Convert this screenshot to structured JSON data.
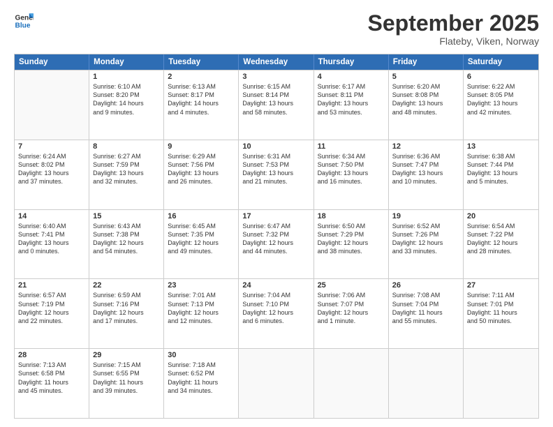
{
  "header": {
    "logo_general": "General",
    "logo_blue": "Blue",
    "month": "September 2025",
    "location": "Flateby, Viken, Norway"
  },
  "days": [
    "Sunday",
    "Monday",
    "Tuesday",
    "Wednesday",
    "Thursday",
    "Friday",
    "Saturday"
  ],
  "rows": [
    [
      {
        "day": "",
        "lines": []
      },
      {
        "day": "1",
        "lines": [
          "Sunrise: 6:10 AM",
          "Sunset: 8:20 PM",
          "Daylight: 14 hours",
          "and 9 minutes."
        ]
      },
      {
        "day": "2",
        "lines": [
          "Sunrise: 6:13 AM",
          "Sunset: 8:17 PM",
          "Daylight: 14 hours",
          "and 4 minutes."
        ]
      },
      {
        "day": "3",
        "lines": [
          "Sunrise: 6:15 AM",
          "Sunset: 8:14 PM",
          "Daylight: 13 hours",
          "and 58 minutes."
        ]
      },
      {
        "day": "4",
        "lines": [
          "Sunrise: 6:17 AM",
          "Sunset: 8:11 PM",
          "Daylight: 13 hours",
          "and 53 minutes."
        ]
      },
      {
        "day": "5",
        "lines": [
          "Sunrise: 6:20 AM",
          "Sunset: 8:08 PM",
          "Daylight: 13 hours",
          "and 48 minutes."
        ]
      },
      {
        "day": "6",
        "lines": [
          "Sunrise: 6:22 AM",
          "Sunset: 8:05 PM",
          "Daylight: 13 hours",
          "and 42 minutes."
        ]
      }
    ],
    [
      {
        "day": "7",
        "lines": [
          "Sunrise: 6:24 AM",
          "Sunset: 8:02 PM",
          "Daylight: 13 hours",
          "and 37 minutes."
        ]
      },
      {
        "day": "8",
        "lines": [
          "Sunrise: 6:27 AM",
          "Sunset: 7:59 PM",
          "Daylight: 13 hours",
          "and 32 minutes."
        ]
      },
      {
        "day": "9",
        "lines": [
          "Sunrise: 6:29 AM",
          "Sunset: 7:56 PM",
          "Daylight: 13 hours",
          "and 26 minutes."
        ]
      },
      {
        "day": "10",
        "lines": [
          "Sunrise: 6:31 AM",
          "Sunset: 7:53 PM",
          "Daylight: 13 hours",
          "and 21 minutes."
        ]
      },
      {
        "day": "11",
        "lines": [
          "Sunrise: 6:34 AM",
          "Sunset: 7:50 PM",
          "Daylight: 13 hours",
          "and 16 minutes."
        ]
      },
      {
        "day": "12",
        "lines": [
          "Sunrise: 6:36 AM",
          "Sunset: 7:47 PM",
          "Daylight: 13 hours",
          "and 10 minutes."
        ]
      },
      {
        "day": "13",
        "lines": [
          "Sunrise: 6:38 AM",
          "Sunset: 7:44 PM",
          "Daylight: 13 hours",
          "and 5 minutes."
        ]
      }
    ],
    [
      {
        "day": "14",
        "lines": [
          "Sunrise: 6:40 AM",
          "Sunset: 7:41 PM",
          "Daylight: 13 hours",
          "and 0 minutes."
        ]
      },
      {
        "day": "15",
        "lines": [
          "Sunrise: 6:43 AM",
          "Sunset: 7:38 PM",
          "Daylight: 12 hours",
          "and 54 minutes."
        ]
      },
      {
        "day": "16",
        "lines": [
          "Sunrise: 6:45 AM",
          "Sunset: 7:35 PM",
          "Daylight: 12 hours",
          "and 49 minutes."
        ]
      },
      {
        "day": "17",
        "lines": [
          "Sunrise: 6:47 AM",
          "Sunset: 7:32 PM",
          "Daylight: 12 hours",
          "and 44 minutes."
        ]
      },
      {
        "day": "18",
        "lines": [
          "Sunrise: 6:50 AM",
          "Sunset: 7:29 PM",
          "Daylight: 12 hours",
          "and 38 minutes."
        ]
      },
      {
        "day": "19",
        "lines": [
          "Sunrise: 6:52 AM",
          "Sunset: 7:26 PM",
          "Daylight: 12 hours",
          "and 33 minutes."
        ]
      },
      {
        "day": "20",
        "lines": [
          "Sunrise: 6:54 AM",
          "Sunset: 7:22 PM",
          "Daylight: 12 hours",
          "and 28 minutes."
        ]
      }
    ],
    [
      {
        "day": "21",
        "lines": [
          "Sunrise: 6:57 AM",
          "Sunset: 7:19 PM",
          "Daylight: 12 hours",
          "and 22 minutes."
        ]
      },
      {
        "day": "22",
        "lines": [
          "Sunrise: 6:59 AM",
          "Sunset: 7:16 PM",
          "Daylight: 12 hours",
          "and 17 minutes."
        ]
      },
      {
        "day": "23",
        "lines": [
          "Sunrise: 7:01 AM",
          "Sunset: 7:13 PM",
          "Daylight: 12 hours",
          "and 12 minutes."
        ]
      },
      {
        "day": "24",
        "lines": [
          "Sunrise: 7:04 AM",
          "Sunset: 7:10 PM",
          "Daylight: 12 hours",
          "and 6 minutes."
        ]
      },
      {
        "day": "25",
        "lines": [
          "Sunrise: 7:06 AM",
          "Sunset: 7:07 PM",
          "Daylight: 12 hours",
          "and 1 minute."
        ]
      },
      {
        "day": "26",
        "lines": [
          "Sunrise: 7:08 AM",
          "Sunset: 7:04 PM",
          "Daylight: 11 hours",
          "and 55 minutes."
        ]
      },
      {
        "day": "27",
        "lines": [
          "Sunrise: 7:11 AM",
          "Sunset: 7:01 PM",
          "Daylight: 11 hours",
          "and 50 minutes."
        ]
      }
    ],
    [
      {
        "day": "28",
        "lines": [
          "Sunrise: 7:13 AM",
          "Sunset: 6:58 PM",
          "Daylight: 11 hours",
          "and 45 minutes."
        ]
      },
      {
        "day": "29",
        "lines": [
          "Sunrise: 7:15 AM",
          "Sunset: 6:55 PM",
          "Daylight: 11 hours",
          "and 39 minutes."
        ]
      },
      {
        "day": "30",
        "lines": [
          "Sunrise: 7:18 AM",
          "Sunset: 6:52 PM",
          "Daylight: 11 hours",
          "and 34 minutes."
        ]
      },
      {
        "day": "",
        "lines": []
      },
      {
        "day": "",
        "lines": []
      },
      {
        "day": "",
        "lines": []
      },
      {
        "day": "",
        "lines": []
      }
    ]
  ]
}
